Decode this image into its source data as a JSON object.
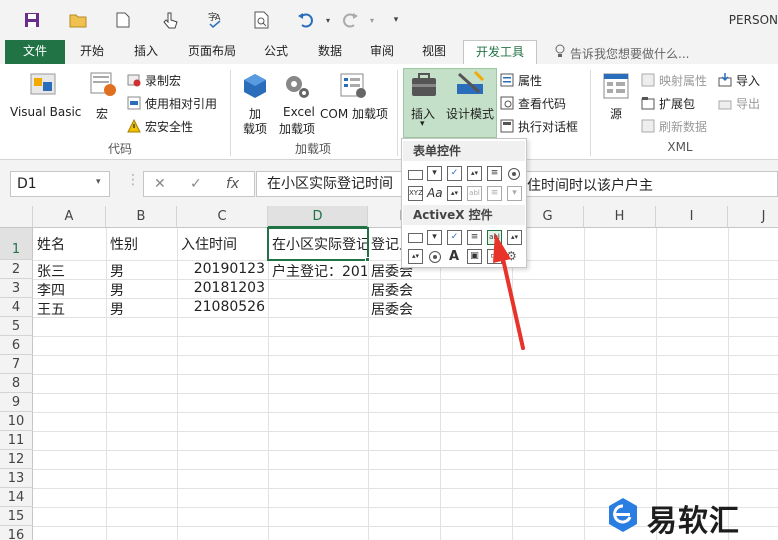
{
  "app": {
    "title": "PERSON"
  },
  "tabs": [
    "文件",
    "开始",
    "插入",
    "页面布局",
    "公式",
    "数据",
    "审阅",
    "视图",
    "开发工具"
  ],
  "tell_me": "告诉我您想要做什么...",
  "ribbon": {
    "code": {
      "visual_basic": "Visual Basic",
      "macros": "宏",
      "record": "录制宏",
      "relative": "使用相对引用",
      "security": "宏安全性",
      "label": "代码"
    },
    "addins": {
      "addins_1": "加",
      "addins_2": "载项",
      "excel_1": "Excel",
      "excel_2": "加载项",
      "com": "COM 加载项",
      "label": "加载项"
    },
    "controls": {
      "insert": "插入",
      "design": "设计模式",
      "properties": "属性",
      "view_code": "查看代码",
      "dialog": "执行对话框"
    },
    "source": {
      "source": "源",
      "map_props": "映射属性",
      "expansion": "扩展包",
      "refresh": "刷新数据",
      "import": "导入",
      "export": "导出",
      "label": "XML"
    }
  },
  "dropdown": {
    "form_controls": "表单控件",
    "activex_controls": "ActiveX 控件"
  },
  "formula_bar": {
    "name_box": "D1",
    "fx": "fx",
    "content": "在小区实际登记时间",
    "content_tail": "住时间时以该户户主"
  },
  "columns": [
    "A",
    "B",
    "C",
    "D",
    "E",
    "F",
    "G",
    "H",
    "I",
    "J"
  ],
  "rows": [
    "1",
    "2",
    "3",
    "4",
    "5",
    "6",
    "7",
    "8",
    "9",
    "10",
    "11",
    "12",
    "13",
    "14",
    "15",
    "16"
  ],
  "cells": {
    "a1": "姓名",
    "b1": "性别",
    "c1": "入住时间",
    "d1": "在小区实际登记",
    "e1": "登记人",
    "a2": "张三",
    "b2": "男",
    "c2": "20190123",
    "d2": "户主登记：201",
    "e2": "居委会",
    "a3": "李四",
    "b3": "男",
    "c3": "20181203",
    "e3": "居委会",
    "a4": "王五",
    "b4": "男",
    "c4": "21080526",
    "e4": "居委会"
  },
  "watermark": {
    "text": "易软汇"
  }
}
